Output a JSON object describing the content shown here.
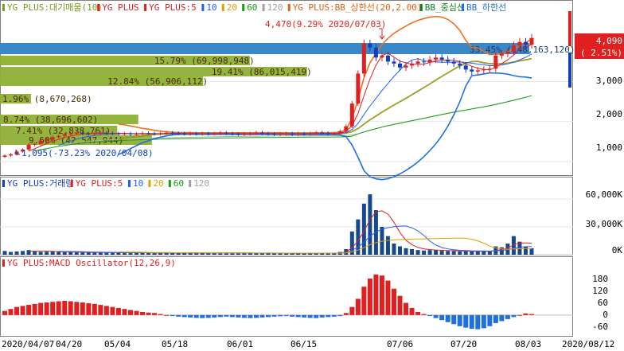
{
  "colors": {
    "up": "#e02020",
    "down": "#1040c0",
    "green_bar": "#8fb035",
    "ma5": "#e02020",
    "ma10": "#2060ff",
    "ma20": "#e0a000",
    "ma60": "#10a010",
    "ma120": "#a0a0a0",
    "bb_upper": "#f07020",
    "bb_mid": "#108020",
    "bb_lower": "#2070e0",
    "highlight": "#3a88c8",
    "price_box": "#e02020"
  },
  "price_panel": {
    "legend": [
      {
        "swatch": "green-bar",
        "text": "YG PLUS:대기매물(10)",
        "color": "#7a9a20"
      },
      {
        "swatch": "candle",
        "text": "YG PLUS",
        "color": "#e02020"
      },
      {
        "swatch": "line",
        "text": "YG PLUS:5",
        "color": "#e02020"
      },
      {
        "swatch": "line",
        "text": "10",
        "color": "#2060ff"
      },
      {
        "swatch": "line",
        "text": "20",
        "color": "#e0a000"
      },
      {
        "swatch": "line",
        "text": "60",
        "color": "#10a010"
      },
      {
        "swatch": "line",
        "text": "120",
        "color": "#a0a0a0"
      },
      {
        "swatch": "line",
        "text": "YG PLUS:BB_상한선(20,2.00)",
        "color": "#e06010"
      },
      {
        "swatch": "line",
        "text": "BB_중심선",
        "color": "#108020"
      },
      {
        "swatch": "line",
        "text": "BB_하한선",
        "color": "#2070e0"
      }
    ],
    "y_ticks": [
      "3,000",
      "2,000",
      "1,000"
    ],
    "current_price": "4,090",
    "current_change": "( 2.51%)",
    "high_annotation": "4,470(9.29% 2020/07/03)",
    "low_annotation": "1,095(-73.23% 2020/04/08)",
    "volume_profile": [
      {
        "label": "33.45% (148,163,120)",
        "share": 33.45
      },
      {
        "label": "15.79% (69,998,948)",
        "share": 15.79
      },
      {
        "label": "19.41% (86,015,419)",
        "share": 19.41
      },
      {
        "label": "12.84% (56,906,112)",
        "share": 12.84
      },
      {
        "label": "1.96% (8,670,268)",
        "share": 1.96
      },
      {
        "label": "8.74% (38,696,602)",
        "share": 8.74
      },
      {
        "label": "7.41% (32,838,761)",
        "share": 7.41
      },
      {
        "label": "9.60% (42,547,944)",
        "share": 9.6
      }
    ]
  },
  "volume_panel": {
    "legend": [
      {
        "swatch": "bar",
        "text": "YG PLUS:거래량",
        "color": "#1040c0"
      },
      {
        "swatch": "line",
        "text": "YG PLUS:5",
        "color": "#e02020"
      },
      {
        "swatch": "line",
        "text": "10",
        "color": "#2060ff"
      },
      {
        "swatch": "line",
        "text": "20",
        "color": "#e0a000"
      },
      {
        "swatch": "line",
        "text": "60",
        "color": "#10a010"
      },
      {
        "swatch": "line",
        "text": "120",
        "color": "#a0a0a0"
      }
    ],
    "y_ticks": [
      "60,000K",
      "30,000K",
      "0K"
    ]
  },
  "macd_panel": {
    "legend": [
      {
        "swatch": "bar",
        "text": "YG PLUS:MACD Oscillator(12,26,9)",
        "color": "#e02020"
      }
    ],
    "y_ticks": [
      "180",
      "120",
      "60",
      "0",
      "-60"
    ]
  },
  "x_axis": {
    "labels": [
      "2020/04/07",
      "04/20",
      "05/04",
      "05/18",
      "06/01",
      "06/15",
      "07/06",
      "07/20",
      "08/03",
      "2020/08/12"
    ]
  },
  "chart_data": [
    {
      "type": "candlestick",
      "title": "YG PLUS",
      "x": [
        "04/07",
        "04/08",
        "04/09",
        "04/10",
        "04/13",
        "04/14",
        "04/15",
        "04/16",
        "04/17",
        "04/20",
        "04/21",
        "04/22",
        "04/23",
        "04/24",
        "04/27",
        "04/28",
        "04/29",
        "05/04",
        "05/06",
        "05/07",
        "05/08",
        "05/11",
        "05/12",
        "05/13",
        "05/14",
        "05/15",
        "05/18",
        "05/19",
        "05/20",
        "05/21",
        "05/22",
        "05/25",
        "05/26",
        "05/27",
        "05/28",
        "05/29",
        "06/01",
        "06/02",
        "06/03",
        "06/04",
        "06/05",
        "06/08",
        "06/09",
        "06/10",
        "06/11",
        "06/12",
        "06/15",
        "06/16",
        "06/17",
        "06/18",
        "06/19",
        "06/22",
        "06/23",
        "06/24",
        "06/25",
        "06/26",
        "06/29",
        "06/30",
        "07/01",
        "07/02",
        "07/03",
        "07/06",
        "07/07",
        "07/08",
        "07/09",
        "07/10",
        "07/13",
        "07/14",
        "07/15",
        "07/16",
        "07/17",
        "07/20",
        "07/21",
        "07/22",
        "07/23",
        "07/24",
        "07/27",
        "07/28",
        "07/29",
        "07/30",
        "07/31",
        "08/03",
        "08/04",
        "08/05",
        "08/06",
        "08/07",
        "08/10",
        "08/11",
        "08/12"
      ],
      "close": [
        1150,
        1180,
        1250,
        1300,
        1420,
        1440,
        1520,
        1560,
        1610,
        1640,
        1680,
        1700,
        1720,
        1700,
        1690,
        1700,
        1720,
        1710,
        1700,
        1690,
        1700,
        1680,
        1690,
        1710,
        1700,
        1690,
        1700,
        1720,
        1710,
        1700,
        1690,
        1700,
        1690,
        1700,
        1690,
        1700,
        1720,
        1700,
        1690,
        1680,
        1690,
        1700,
        1720,
        1700,
        1690,
        1680,
        1690,
        1700,
        1680,
        1700,
        1690,
        1700,
        1720,
        1710,
        1690,
        1700,
        1760,
        1880,
        2450,
        3200,
        3950,
        3850,
        3600,
        3650,
        3500,
        3450,
        3350,
        3400,
        3450,
        3500,
        3480,
        3550,
        3600,
        3550,
        3500,
        3450,
        3400,
        3300,
        3250,
        3280,
        3300,
        3320,
        3650,
        3700,
        3750,
        3900,
        3990,
        3920,
        4090
      ],
      "y_ticks": [
        1000,
        2000,
        3000
      ],
      "ylim": [
        700,
        4800
      ]
    },
    {
      "type": "bar",
      "title": "YG PLUS:거래량",
      "unit": "K",
      "values": [
        4000,
        3000,
        3500,
        4000,
        5000,
        3500,
        3000,
        3200,
        3500,
        3000,
        2800,
        2600,
        2500,
        2400,
        2300,
        2200,
        2400,
        2300,
        2200,
        2100,
        2000,
        2100,
        2200,
        2000,
        1900,
        1800,
        2000,
        2100,
        1900,
        1800,
        1700,
        1800,
        1900,
        1700,
        1600,
        1800,
        2000,
        1900,
        1700,
        1600,
        1700,
        1800,
        1900,
        1700,
        1600,
        1500,
        1600,
        1700,
        1500,
        1600,
        1700,
        1600,
        1800,
        1700,
        1600,
        1700,
        3000,
        6000,
        25000,
        38000,
        55000,
        65000,
        48000,
        30000,
        20000,
        12000,
        9000,
        7000,
        6000,
        5000,
        4500,
        5000,
        4800,
        4200,
        4000,
        3800,
        3500,
        4000,
        3600,
        3400,
        3500,
        3600,
        9000,
        8000,
        12000,
        20000,
        14000,
        9000,
        7000
      ],
      "y_ticks": [
        0,
        30000,
        60000
      ],
      "ylim": [
        0,
        72000
      ]
    },
    {
      "type": "bar",
      "title": "YG PLUS:MACD Oscillator(12,26,9)",
      "values": [
        20,
        30,
        40,
        45,
        50,
        55,
        60,
        62,
        65,
        68,
        70,
        68,
        65,
        62,
        58,
        55,
        50,
        45,
        40,
        35,
        30,
        25,
        20,
        15,
        12,
        10,
        5,
        0,
        -5,
        -8,
        -10,
        -12,
        -14,
        -15,
        -14,
        -12,
        -10,
        -8,
        -10,
        -12,
        -14,
        -15,
        -14,
        -12,
        -10,
        -8,
        -6,
        -5,
        -8,
        -10,
        -12,
        -14,
        -15,
        -12,
        -10,
        -8,
        -5,
        10,
        40,
        80,
        140,
        180,
        200,
        195,
        170,
        130,
        95,
        60,
        35,
        15,
        5,
        -5,
        -15,
        -25,
        -35,
        -45,
        -55,
        -62,
        -68,
        -70,
        -65,
        -55,
        -40,
        -30,
        -20,
        -10,
        0,
        8,
        5
      ],
      "y_ticks": [
        -60,
        0,
        60,
        120,
        180
      ],
      "ylim": [
        -95,
        235
      ]
    }
  ]
}
